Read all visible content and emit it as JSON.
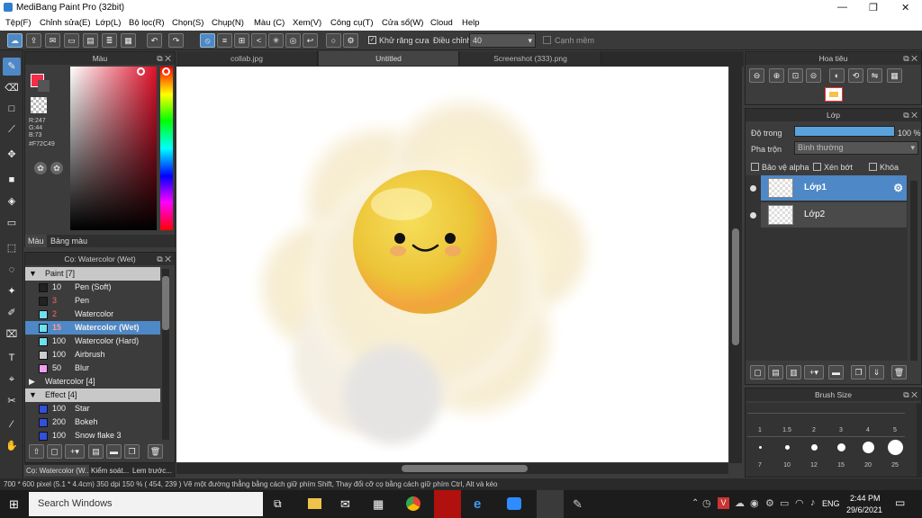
{
  "window": {
    "title": "MediBang Paint Pro (32bit)",
    "controls": [
      "—",
      "❐",
      "✕"
    ]
  },
  "menu": [
    "Tệp(F)",
    "Chỉnh sửa(E)",
    "Lớp(L)",
    "Bộ lọc(R)",
    "Chọn(S)",
    "Chụp(N)",
    "Màu (C)",
    "Xem(V)",
    "Công cụ(T)",
    "Cửa sổ(W)",
    "Cloud",
    "Help"
  ],
  "toolbar": {
    "antialias_label": "Khử răng cưa",
    "adjust_label": "Điều chỉnh",
    "adjust_value": "40",
    "edge_label": "Cạnh mềm"
  },
  "color_panel": {
    "title": "Màu",
    "r": "R:247",
    "g": "G:44",
    "b": "B:73",
    "hex": "#F72C49",
    "primary": "#f72c49",
    "tabs": [
      "Màu",
      "Bảng màu"
    ]
  },
  "brush_panel": {
    "title": "Cọ: Watercolor (Wet)",
    "groups": [
      {
        "name": "Paint [7]",
        "open": true,
        "items": [
          {
            "size": "10",
            "name": "Pen (Soft)",
            "color": "#222222"
          },
          {
            "size": "3",
            "name": "Pen",
            "color": "#222222",
            "red": true
          },
          {
            "size": "2",
            "name": "Watercolor",
            "color": "#6ee0f0",
            "red": true
          },
          {
            "size": "15",
            "name": "Watercolor (Wet)",
            "color": "#6ee0f0",
            "selected": true
          },
          {
            "size": "100",
            "name": "Watercolor (Hard)",
            "color": "#6ee0f0"
          },
          {
            "size": "100",
            "name": "Airbrush",
            "color": "#cccccc"
          },
          {
            "size": "50",
            "name": "Blur",
            "color": "#f0a0f0"
          }
        ]
      },
      {
        "name": "Watercolor [4]",
        "open": false,
        "items": []
      },
      {
        "name": "Effect [4]",
        "open": true,
        "items": [
          {
            "size": "100",
            "name": "Star",
            "color": "#3050e0"
          },
          {
            "size": "200",
            "name": "Bokeh",
            "color": "#3050e0"
          },
          {
            "size": "100",
            "name": "Snow flake 3",
            "color": "#3050e0"
          }
        ]
      }
    ]
  },
  "bottom_tabs": [
    "Cọ: Watercolor (W...",
    "Kiểm soát...",
    "Lem trước..."
  ],
  "doc_tabs": [
    "collab.jpg",
    "Untitled",
    "Screenshot (333).png"
  ],
  "navigator": {
    "title": "Hoa tiêu"
  },
  "layer_panel": {
    "title": "Lớp",
    "opacity_label": "Độ trong",
    "opacity_value": "100 %",
    "opacity": 1.0,
    "blend_label": "Pha trộn",
    "blend_value": "Bình thường",
    "protect_alpha": "Bảo vệ alpha",
    "clip": "Xén bớt",
    "lock": "Khóa",
    "layers": [
      "Lớp1",
      "Lớp2"
    ]
  },
  "brush_size": {
    "title": "Brush Size",
    "row1": [
      "1",
      "1.5",
      "2",
      "3",
      "4",
      "5"
    ],
    "row2": [
      "7",
      "10",
      "12",
      "15",
      "20",
      "25"
    ]
  },
  "status": {
    "text": "700 * 600 pixel  (5.1 * 4.4cm)  350 dpi  150 %  ( 454, 239 )  Vẽ một đường thẳng bằng cách giữ phím Shift, Thay đổi cỡ cọ bằng cách giữ phím Ctrl, Alt và kéo"
  },
  "taskbar": {
    "search": "Search Windows",
    "lang": "ENG",
    "time": "2:44 PM",
    "date": "29/6/2021"
  }
}
